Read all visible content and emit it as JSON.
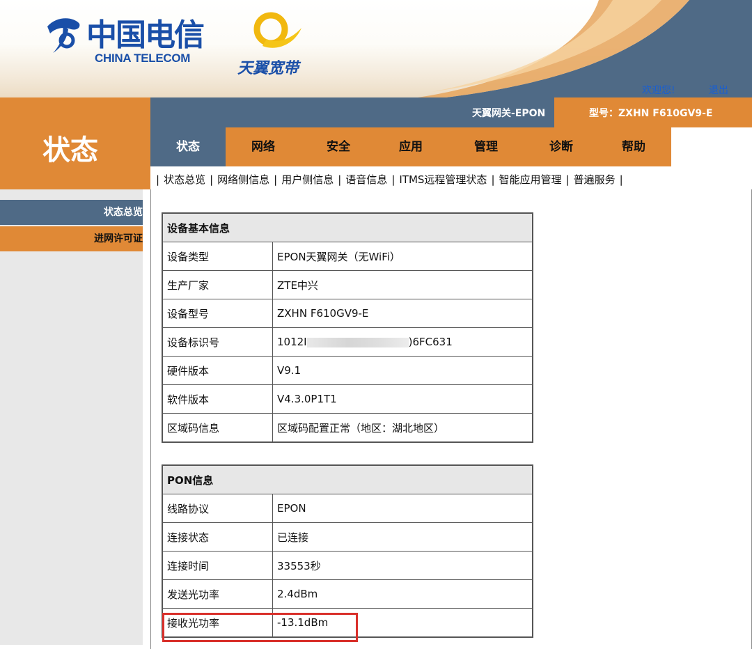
{
  "header": {
    "brand_cn": "中国电信",
    "brand_en": "CHINA TELECOM",
    "sub_brand": "天翼宽带",
    "welcome": "欢迎您!",
    "logout": "退出",
    "colors": {
      "brand_blue": "#1a4fa8",
      "orange": "#e08936",
      "slate": "#4f6a86"
    }
  },
  "page_title": "状态",
  "info_bar": {
    "gateway_name": "天翼网关-EPON",
    "model_text": "型号：ZXHN F610GV9-E"
  },
  "tabs": [
    {
      "label": "状态",
      "active": true
    },
    {
      "label": "网络",
      "active": false
    },
    {
      "label": "安全",
      "active": false
    },
    {
      "label": "应用",
      "active": false
    },
    {
      "label": "管理",
      "active": false
    },
    {
      "label": "诊断",
      "active": false
    },
    {
      "label": "帮助",
      "active": false
    }
  ],
  "sub_nav": [
    "状态总览",
    "网络侧信息",
    "用户侧信息",
    "语音信息",
    "ITMS远程管理状态",
    "智能应用管理",
    "普遍服务"
  ],
  "sidebar": {
    "items": [
      {
        "label": "状态总览",
        "active": true
      },
      {
        "label": "进网许可证",
        "active": false
      }
    ]
  },
  "device_info": {
    "title": "设备基本信息",
    "rows": [
      {
        "key": "设备类型",
        "value": "EPON天翼网关（无WiFi）"
      },
      {
        "key": "生产厂家",
        "value": "ZTE中兴"
      },
      {
        "key": "设备型号",
        "value": "ZXHN F610GV9-E"
      },
      {
        "key": "设备标识号",
        "value_prefix": "1012I",
        "value_suffix": ")6FC631",
        "blurred": true
      },
      {
        "key": "硬件版本",
        "value": "V9.1"
      },
      {
        "key": "软件版本",
        "value": "V4.3.0P1T1"
      },
      {
        "key": "区域码信息",
        "value": "区域码配置正常（地区：湖北地区）"
      }
    ]
  },
  "pon_info": {
    "title": "PON信息",
    "rows": [
      {
        "key": "线路协议",
        "value": "EPON"
      },
      {
        "key": "连接状态",
        "value": "已连接"
      },
      {
        "key": "连接时间",
        "value": "33553秒"
      },
      {
        "key": "发送光功率",
        "value": "2.4dBm"
      },
      {
        "key": "接收光功率",
        "value": "-13.1dBm",
        "highlighted": true
      }
    ]
  }
}
